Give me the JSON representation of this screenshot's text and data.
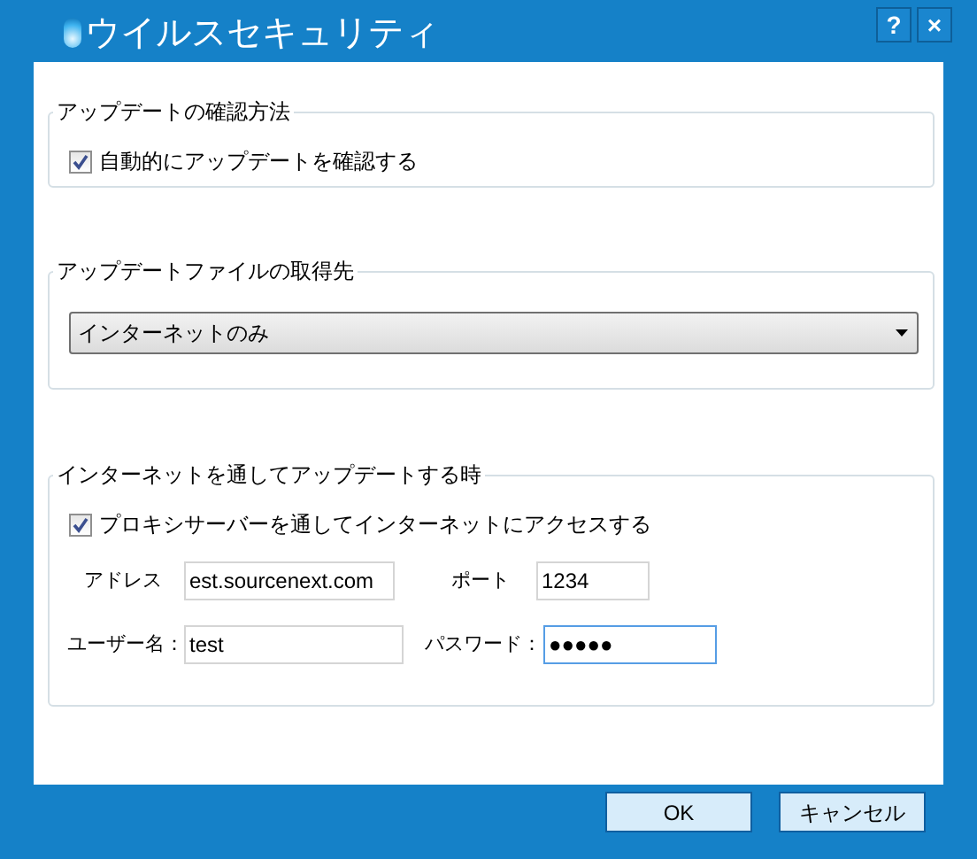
{
  "window": {
    "title": "ウイルスセキュリティ"
  },
  "title_buttons": [
    "?",
    "×"
  ],
  "sections": [
    {
      "legend": "アップデートの確認方法",
      "checkbox": {
        "label": "自動的にアップデートを確認する",
        "checked": true
      }
    },
    {
      "legend": "アップデートファイルの取得先",
      "dropdown": {
        "value": "インターネットのみ"
      }
    },
    {
      "legend": "インターネットを通してアップデートする時",
      "checkbox": {
        "label": "プロキシサーバーを通してインターネットにアクセスする",
        "checked": true
      },
      "fields": [
        {
          "label": "アドレス",
          "value": "est.sourcenext.com",
          "focused": false
        },
        {
          "label": "ポート",
          "value": "1234",
          "focused": false
        },
        {
          "label": "ユーザー名：",
          "value": "test",
          "focused": false
        },
        {
          "label": "パスワード：",
          "value": "●●●●●",
          "focused": true
        }
      ]
    }
  ],
  "buttons": [
    "OK",
    "キャンセル"
  ]
}
